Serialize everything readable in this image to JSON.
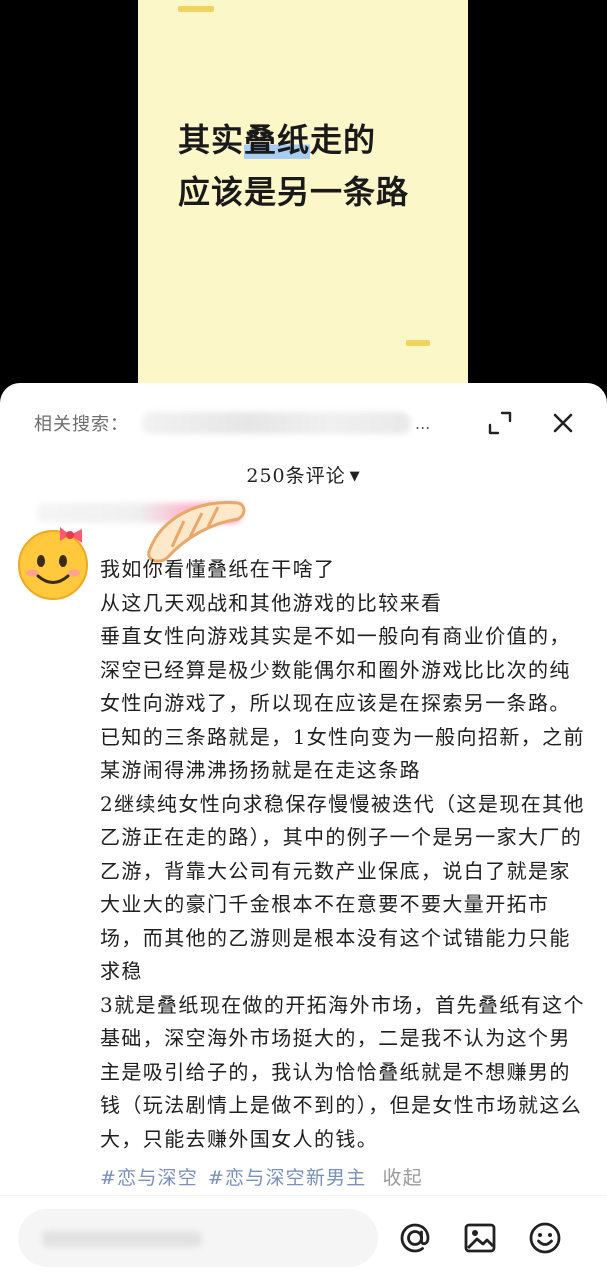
{
  "poster": {
    "headline_part1": "其实",
    "headline_highlight": "叠纸",
    "headline_part2": "走的",
    "headline_line2": "应该是另一条路"
  },
  "header": {
    "related_search_label": "相关搜索：",
    "more_glyph": "...",
    "fold_icon": "collapse-arrows-icon",
    "close_icon": "close-icon"
  },
  "comments": {
    "count_label": "250条评论",
    "caret": "▼"
  },
  "comment": {
    "paragraphs": [
      "我如你看懂叠纸在干啥了",
      "从这几天观战和其他游戏的比较来看",
      "垂直女性向游戏其实是不如一般向有商业价值的，深空已经算是极少数能偶尔和圈外游戏比比次的纯女性向游戏了，所以现在应该是在探索另一条路。",
      "已知的三条路就是，1女性向变为一般向招新，之前某游闹得沸沸扬扬就是在走这条路",
      "2继续纯女性向求稳保存慢慢被迭代（这是现在其他乙游正在走的路），其中的例子一个是另一家大厂的乙游，背靠大公司有元数产业保底，说白了就是家大业大的豪门千金根本不在意要不要大量开拓市场，而其他的乙游则是根本没有这个试错能力只能求稳",
      "3就是叠纸现在做的开拓海外市场，首先叠纸有这个基础，深空海外市场挺大的，二是我不认为这个男主是吸引给子的，我认为恰恰叠纸就是不想赚男的钱（玩法剧情上是做不到的），但是女性市场就这么大，只能去赚外国女人的钱。"
    ],
    "tags": [
      "#恋与深空",
      "#恋与深空新男主"
    ],
    "collapse_label": "收起"
  },
  "bottom_bar": {
    "icons": [
      "at-icon",
      "image-icon",
      "emoji-icon"
    ]
  }
}
